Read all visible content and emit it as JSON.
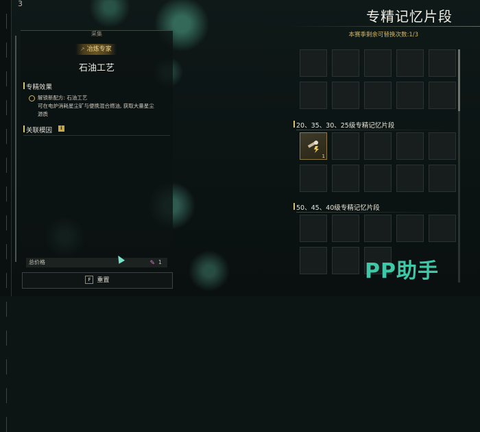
{
  "top_left_counter": "3",
  "left_panel": {
    "category": "采集",
    "badge": "冶炼专家",
    "title": "石油工艺",
    "effects_heading": "专精效果",
    "effect_lines": [
      "解锁新配方: 石油工艺",
      "可在电炉消耗星尘矿与便携混合燃油, 获取大量星尘",
      "源质"
    ],
    "related_heading": "关联模因",
    "total_label": "总价格",
    "total_value": "1",
    "reset_key": "F",
    "reset_label": "重置"
  },
  "right_panel": {
    "title": "专精记忆片段",
    "subtitle": "本赛季剩余可替换次数:1/3",
    "group1": "20、35、30、25级专精记忆片段",
    "group2": "50、45、40级专精记忆片段",
    "item_count": "1"
  },
  "watermark": "PP助手",
  "colors": {
    "accent_gold": "#d3b766",
    "accent_teal": "#3fc8a8"
  }
}
